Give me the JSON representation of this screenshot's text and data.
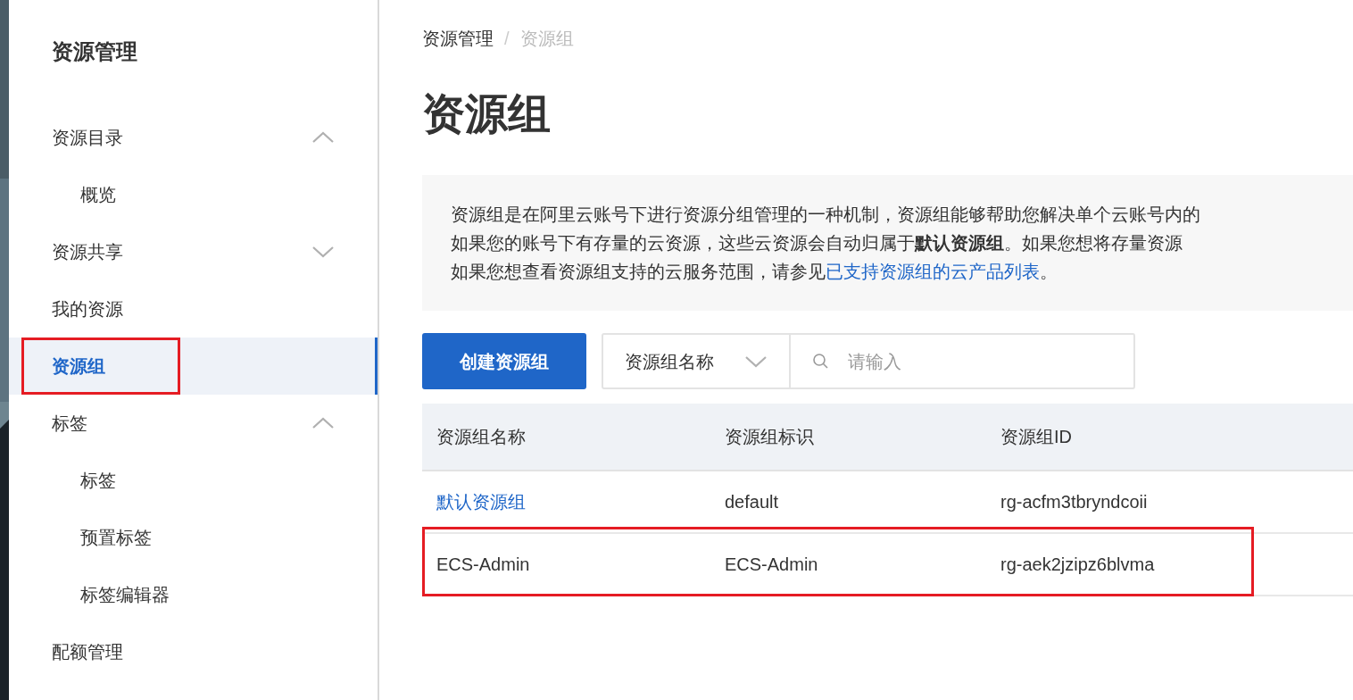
{
  "sidebar": {
    "title": "资源管理",
    "items": [
      {
        "label": "资源目录",
        "selected": false,
        "highlighted": false,
        "expanded": true,
        "children": [
          {
            "label": "概览",
            "selected": false,
            "highlighted": false
          }
        ]
      },
      {
        "label": "资源共享",
        "selected": false,
        "highlighted": false,
        "expanded": false
      },
      {
        "label": "我的资源",
        "selected": false,
        "highlighted": false
      },
      {
        "label": "资源组",
        "selected": true,
        "highlighted": true
      },
      {
        "label": "标签",
        "selected": false,
        "highlighted": false,
        "expanded": true,
        "children": [
          {
            "label": "标签",
            "selected": false,
            "highlighted": false
          },
          {
            "label": "预置标签",
            "selected": false,
            "highlighted": false
          },
          {
            "label": "标签编辑器",
            "selected": false,
            "highlighted": false
          }
        ]
      },
      {
        "label": "配额管理",
        "selected": false,
        "highlighted": false
      }
    ]
  },
  "breadcrumb": [
    "资源管理",
    "资源组"
  ],
  "breadcrumb_separator": "/",
  "title": "资源组",
  "info": {
    "lines": [
      "资源组是在阿里云账号下进行资源分组管理的一种机制，资源组能够帮助您解决单个云账号内的",
      "如果您的账号下有存量的云资源，这些云资源会自动归属于**默认资源组**。如果您想将存量资源"
    ],
    "last_line": "如果您想查看资源组支持的云服务范围，请参见",
    "link": "已支持资源组的云产品列表",
    "last_line_end": "。"
  },
  "toolbar": {
    "create_button": "创建资源组",
    "filter_select": "资源组名称",
    "search": {
      "placeholder": "请输入"
    }
  },
  "table": {
    "columns": [
      "资源组名称",
      "资源组标识",
      "资源组ID"
    ],
    "rows": [
      {
        "cells": [
          "默认资源组",
          "default",
          "rg-acfm3tbryndcoii"
        ],
        "name_is_link": true,
        "highlighted": false
      },
      {
        "cells": [
          "ECS-Admin",
          "ECS-Admin",
          "rg-aek2jzipz6blvma"
        ],
        "name_is_link": false,
        "highlighted": true
      }
    ]
  }
}
